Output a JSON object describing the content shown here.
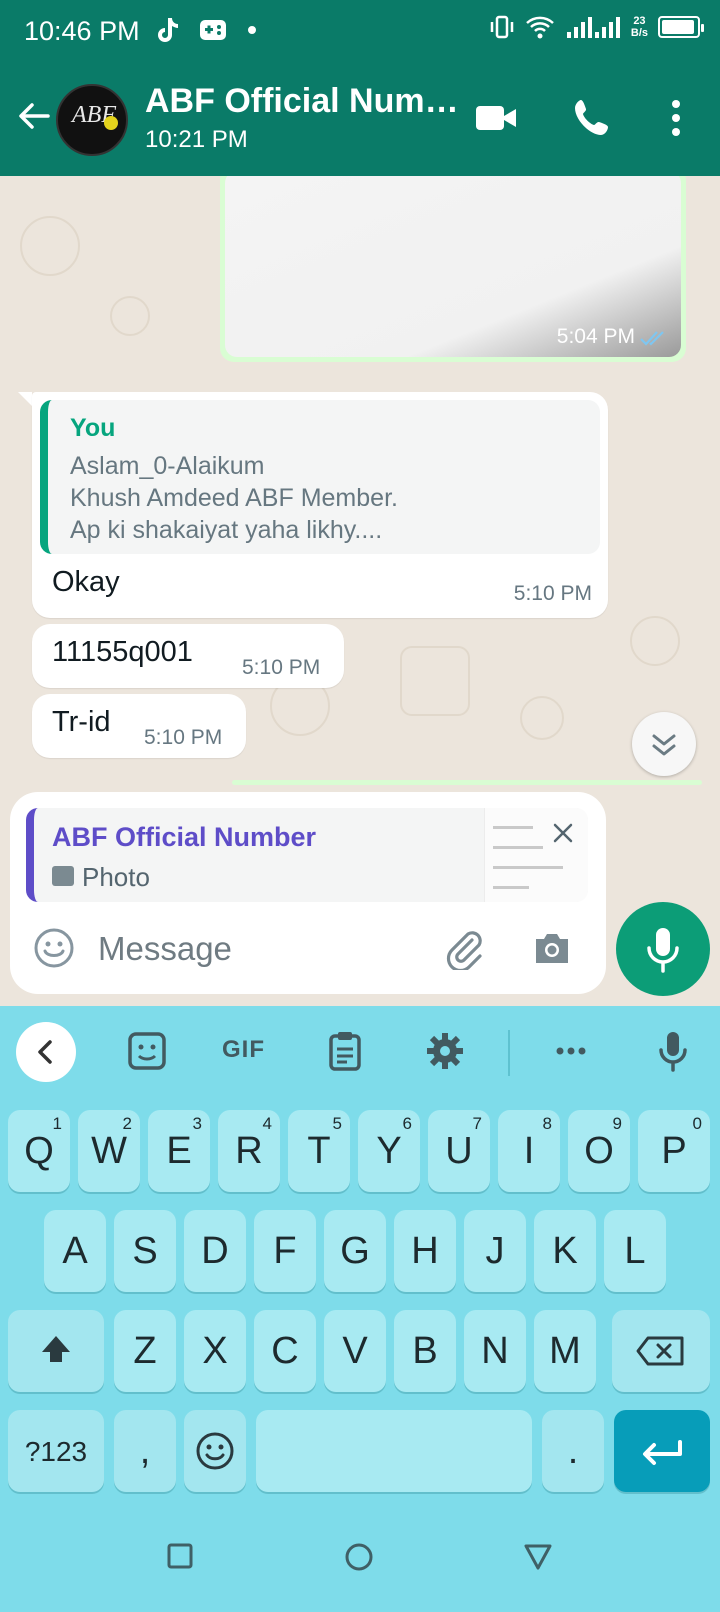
{
  "status_bar": {
    "time": "10:46 PM",
    "net_speed_value": "23",
    "net_speed_unit": "B/s"
  },
  "header": {
    "contact_name": "ABF Official Num…",
    "last_seen": "10:21 PM",
    "avatar_text": "ABF"
  },
  "chat": {
    "image_message": {
      "time": "5:04 PM",
      "status": "read"
    },
    "quoted_message": {
      "sender": "You",
      "lines": [
        "Aslam_0-Alaikum",
        "Khush Amdeed ABF Member.",
        "Ap ki shakaiyat yaha likhy...."
      ]
    },
    "messages": [
      {
        "text": "Okay",
        "time": "5:10 PM"
      },
      {
        "text": "11155q001",
        "time": "5:10 PM"
      },
      {
        "text": "Tr-id",
        "time": "5:10 PM"
      }
    ]
  },
  "composer": {
    "reply_to_name": "ABF Official Number",
    "reply_to_type": "Photo",
    "placeholder": "Message"
  },
  "keyboard": {
    "toolbar": {
      "gif_label": "GIF"
    },
    "row1": [
      {
        "key": "Q",
        "hint": "1"
      },
      {
        "key": "W",
        "hint": "2"
      },
      {
        "key": "E",
        "hint": "3"
      },
      {
        "key": "R",
        "hint": "4"
      },
      {
        "key": "T",
        "hint": "5"
      },
      {
        "key": "Y",
        "hint": "6"
      },
      {
        "key": "U",
        "hint": "7"
      },
      {
        "key": "I",
        "hint": "8"
      },
      {
        "key": "O",
        "hint": "9"
      },
      {
        "key": "P",
        "hint": "0"
      }
    ],
    "row2": [
      "A",
      "S",
      "D",
      "F",
      "G",
      "H",
      "J",
      "K",
      "L"
    ],
    "row3": [
      "Z",
      "X",
      "C",
      "V",
      "B",
      "N",
      "M"
    ],
    "symbols_label": "?123",
    "comma": ",",
    "period": "."
  },
  "colors": {
    "header": "#0a7b68",
    "accent_green": "#06a57e",
    "reply_purple": "#5e4dc8",
    "mic": "#0c9d77",
    "keyboard": "#7edcea",
    "enter_key": "#079db9"
  }
}
